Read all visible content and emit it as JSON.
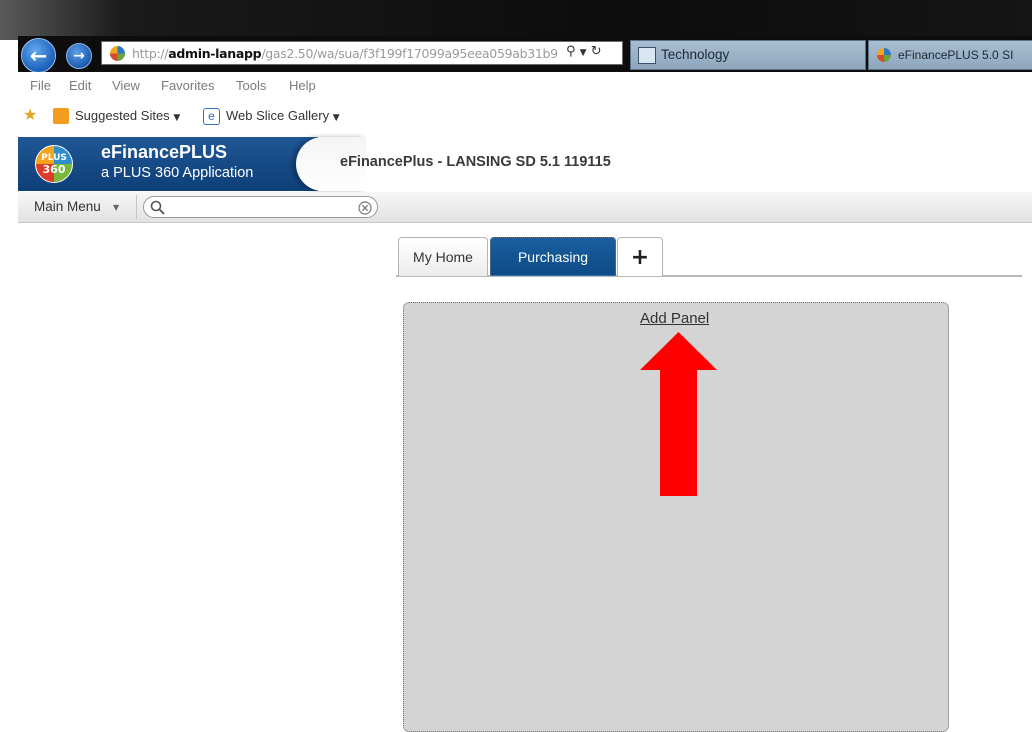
{
  "browser": {
    "url_prefix": "http://",
    "url_host": "admin-lanapp",
    "url_path": "/gas2.50/wa/sua/f3f199f17099a95eea059ab31b9",
    "tabs": [
      {
        "label": "Technology"
      },
      {
        "label": "eFinancePLUS 5.0 SI"
      }
    ],
    "menu": [
      "File",
      "Edit",
      "View",
      "Favorites",
      "Tools",
      "Help"
    ],
    "favorites": [
      {
        "label": "Suggested Sites",
        "icon": "bing-icon"
      },
      {
        "label": "Web Slice Gallery",
        "icon": "ie-icon"
      }
    ]
  },
  "app": {
    "logo_top": "PLUS",
    "logo_bottom": "360",
    "brand_name": "eFinancePLUS",
    "brand_sub": "a PLUS 360 Application",
    "environment_title": "eFinancePlus - LANSING SD 5.1 119115",
    "main_menu_label": "Main Menu",
    "search_placeholder": "",
    "tabs": [
      {
        "label": "My Home",
        "active": false
      },
      {
        "label": "Purchasing",
        "active": true
      },
      {
        "label": "+",
        "active": false
      }
    ],
    "add_panel_label": "Add Panel"
  },
  "colors": {
    "brand_blue": "#1a5592",
    "active_tab": "#0f4f8d",
    "panel_bg": "#d4d4d4",
    "arrow_red": "#ff0000"
  }
}
